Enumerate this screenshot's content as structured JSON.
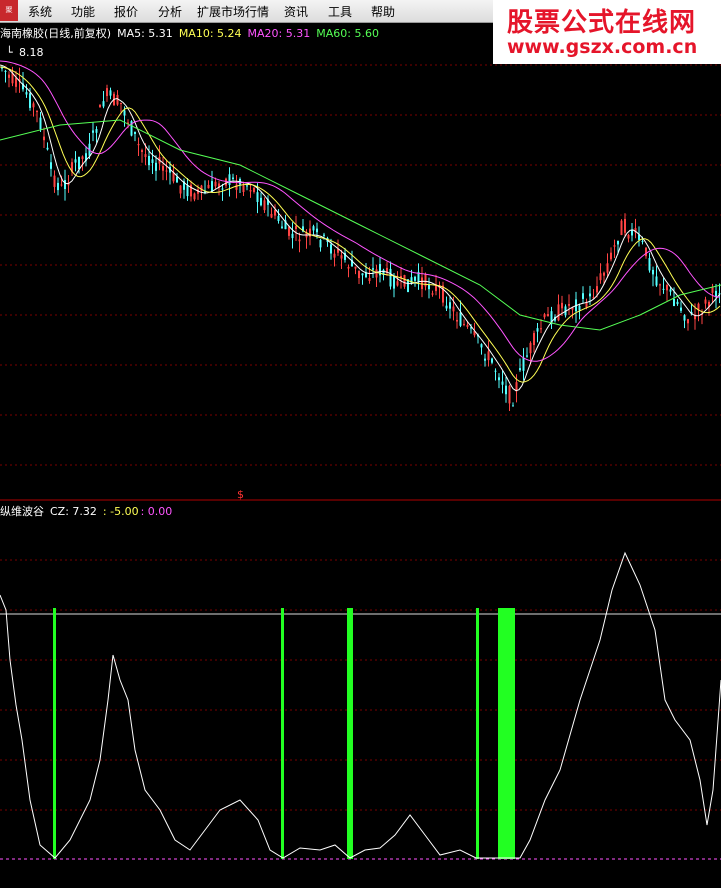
{
  "menu": {
    "logo": "聚",
    "items": [
      "系统",
      "功能",
      "报价",
      "分析",
      "扩展市场行情",
      "资讯",
      "工具",
      "帮助"
    ]
  },
  "watermark": {
    "title": "股票公式在线网",
    "url": "www.gszx.com.cn"
  },
  "main_legend": {
    "name": "海南橡胶(日线,前复权)",
    "ma5": "MA5: 5.31",
    "ma10": "MA10: 5.24",
    "ma20": "MA20: 5.31",
    "ma60": "MA60: 5.60",
    "high_label": "8.18"
  },
  "divider_marker": "$",
  "sub_legend": {
    "name": "纵维波谷",
    "cz": "CZ: 7.32",
    "v1": ": -5.00",
    "v2": ": 0.00"
  },
  "colors": {
    "ma5": "#ffffff",
    "ma10": "#ffff55",
    "ma20": "#ff55ff",
    "ma60": "#55ff55",
    "up": "#ff4444",
    "down": "#55ffff",
    "signal": "#22ff22",
    "grid": "#7a0000"
  },
  "chart_data": [
    {
      "type": "candlestick",
      "title": "海南橡胶(日线,前复权)",
      "series": [
        {
          "name": "MA5",
          "values": [
            5.31
          ]
        },
        {
          "name": "MA10",
          "values": [
            5.24
          ]
        },
        {
          "name": "MA20",
          "values": [
            5.31
          ]
        },
        {
          "name": "MA60",
          "values": [
            5.6
          ]
        }
      ],
      "annotations": [
        "8.18"
      ]
    },
    {
      "type": "line",
      "title": "纵维波谷",
      "series": [
        {
          "name": "CZ",
          "values": [
            7.32
          ]
        }
      ],
      "reference_lines": [
        -5.0,
        0.0
      ]
    }
  ]
}
